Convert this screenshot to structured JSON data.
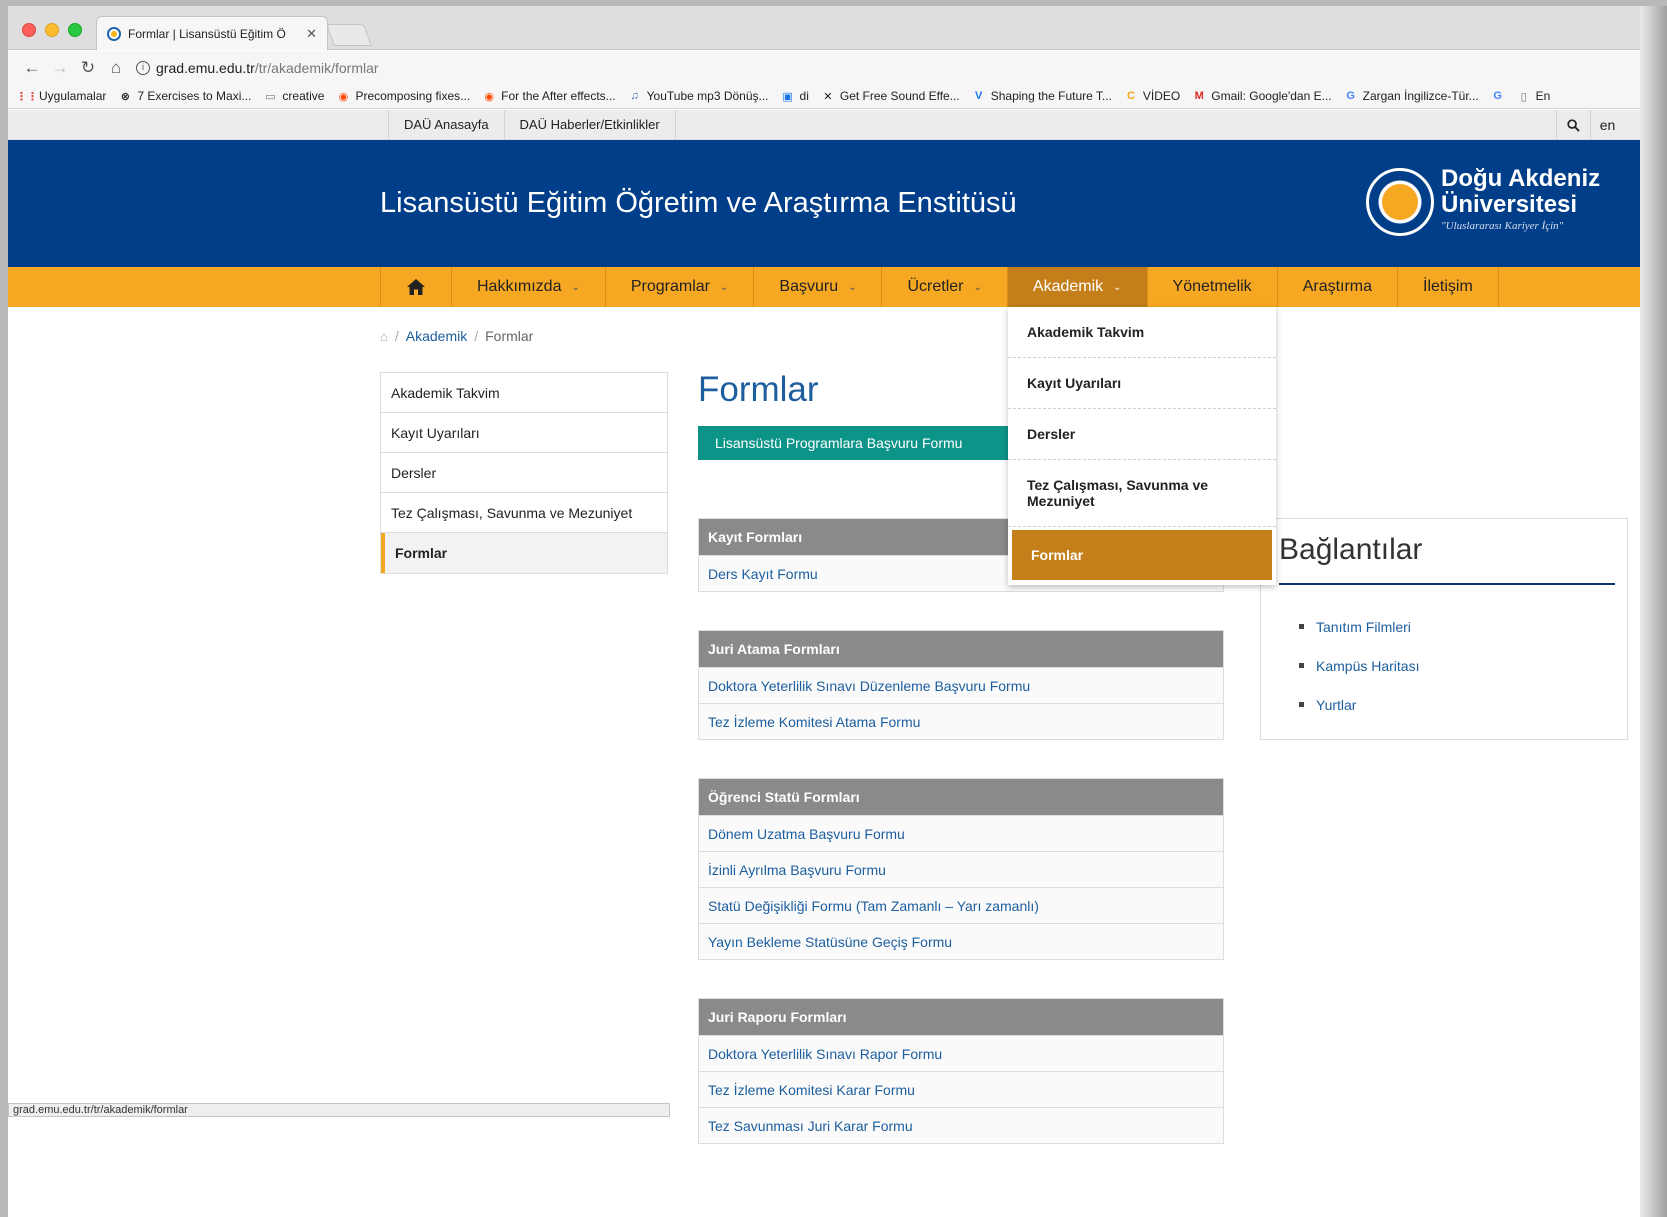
{
  "browser": {
    "tab_title": "Formlar | Lisansüstü Eğitim Ö",
    "url_host": "grad.emu.edu.tr",
    "url_path": "/tr/akademik/formlar",
    "bookmarks": [
      {
        "label": "Uygulamalar",
        "icon": "apps-grid-icon",
        "color": "#e04a3a"
      },
      {
        "label": "7 Exercises to Maxi...",
        "icon": "circle-x-icon",
        "color": "#222222"
      },
      {
        "label": "creative",
        "icon": "folder-icon",
        "color": "#777777"
      },
      {
        "label": "Precomposing fixes...",
        "icon": "reddit-icon",
        "color": "#ff4500"
      },
      {
        "label": "For the After effects...",
        "icon": "reddit-icon",
        "color": "#ff4500"
      },
      {
        "label": "YouTube mp3 Dönüş...",
        "icon": "mp3-icon",
        "color": "#3b6fb6"
      },
      {
        "label": "di",
        "icon": "di-icon",
        "color": "#1a73e8"
      },
      {
        "label": "Get Free Sound Effe...",
        "icon": "x-logo-icon",
        "color": "#222222"
      },
      {
        "label": "Shaping the Future T...",
        "icon": "v-logo-icon",
        "color": "#1a73e8"
      },
      {
        "label": "VİDEO",
        "icon": "c-logo-icon",
        "color": "#f6a315"
      },
      {
        "label": "Gmail: Google'dan E...",
        "icon": "gmail-icon",
        "color": "#d93025"
      },
      {
        "label": "Zargan İngilizce-Tür...",
        "icon": "google-icon",
        "color": "#4285f4"
      },
      {
        "label": "",
        "icon": "google-icon",
        "color": "#4285f4"
      },
      {
        "label": "En",
        "icon": "page-icon",
        "color": "#777777"
      }
    ],
    "status_url": "grad.emu.edu.tr/tr/akademik/formlar"
  },
  "topbar": {
    "links": [
      "DAÜ Anasayfa",
      "DAÜ Haberler/Etkinlikler"
    ],
    "lang": "en"
  },
  "banner": {
    "title": "Lisansüstü Eğitim Öğretim ve Araştırma Enstitüsü",
    "logo_line1": "Doğu Akdeniz",
    "logo_line2": "Üniversitesi",
    "logo_tagline": "\"Uluslararası Kariyer İçin\""
  },
  "nav": {
    "items": [
      {
        "label": "Hakkımızda",
        "dropdown": true
      },
      {
        "label": "Programlar",
        "dropdown": true
      },
      {
        "label": "Başvuru",
        "dropdown": true
      },
      {
        "label": "Ücretler",
        "dropdown": true
      },
      {
        "label": "Akademik",
        "dropdown": true
      },
      {
        "label": "Yönetmelik",
        "dropdown": false
      },
      {
        "label": "Araştırma",
        "dropdown": false
      },
      {
        "label": "İletişim",
        "dropdown": false
      }
    ],
    "active_index": 4,
    "dropdown_items": [
      "Akademik Takvim",
      "Kayıt Uyarıları",
      "Dersler",
      "Tez Çalışması, Savunma ve Mezuniyet",
      "Formlar"
    ],
    "dropdown_active_index": 4
  },
  "breadcrumb": {
    "items": [
      "Akademik",
      "Formlar"
    ]
  },
  "sidemenu": {
    "items": [
      "Akademik Takvim",
      "Kayıt Uyarıları",
      "Dersler",
      "Tez Çalışması, Savunma ve Mezuniyet",
      "Formlar"
    ],
    "active_index": 4
  },
  "main": {
    "title": "Formlar",
    "apply_button": "Lisansüstü Programlara Başvuru Formu",
    "sections": [
      {
        "heading": "Kayıt Formları",
        "links": [
          "Ders Kayıt Formu"
        ]
      },
      {
        "heading": "Juri Atama Formları",
        "links": [
          "Doktora Yeterlilik Sınavı Düzenleme Başvuru Formu",
          "Tez İzleme Komitesi Atama Formu"
        ]
      },
      {
        "heading": "Öğrenci Statü Formları",
        "links": [
          "Dönem Uzatma Başvuru Formu",
          "İzinli Ayrılma Başvuru Formu",
          "Statü Değişikliği Formu (Tam Zamanlı – Yarı zamanlı)",
          "Yayın Bekleme Statüsüne Geçiş Formu"
        ]
      },
      {
        "heading": "Juri Raporu Formları",
        "links": [
          "Doktora Yeterlilik Sınavı Rapor Formu",
          "Tez İzleme Komitesi Karar Formu",
          "Tez Savunması Juri Karar Formu"
        ]
      }
    ]
  },
  "sidebar_links": {
    "title": "Bağlantılar",
    "items": [
      "Tanıtım Filmleri",
      "Kampüs Haritası",
      "Yurtlar"
    ]
  },
  "colors": {
    "brand_blue": "#003e89",
    "nav_orange": "#f7a823",
    "nav_active": "#c47f1a",
    "teal_button": "#0d9488",
    "link_blue": "#1c5e9e"
  }
}
